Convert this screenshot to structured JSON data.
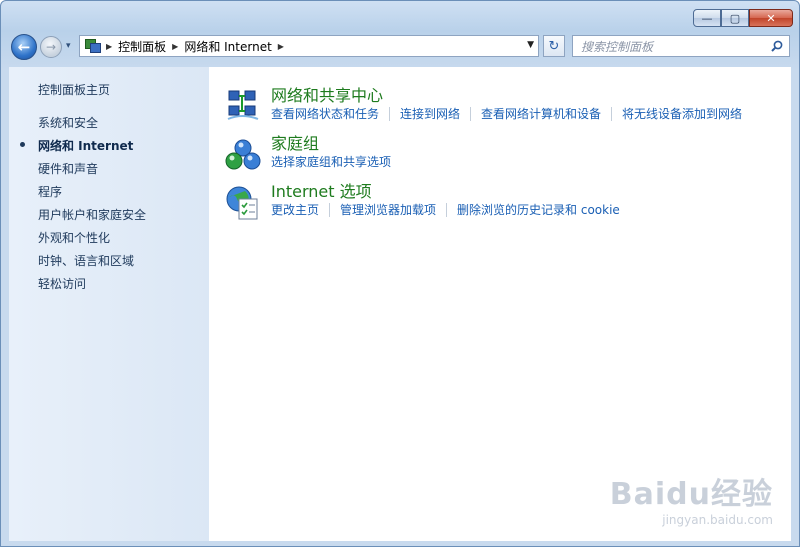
{
  "window": {
    "minimize_glyph": "—",
    "maximize_glyph": "▢",
    "close_glyph": "✕"
  },
  "navigation": {
    "back_glyph": "←",
    "forward_glyph": "→",
    "history_glyph": "▾",
    "breadcrumbs": [
      "控制面板",
      "网络和 Internet"
    ],
    "crumb_separator": "▶",
    "dropdown_glyph": "▼",
    "refresh_glyph": "↻"
  },
  "search": {
    "placeholder": "搜索控制面板"
  },
  "sidebar": {
    "home": "控制面板主页",
    "items": [
      "系统和安全",
      "网络和 Internet",
      "硬件和声音",
      "程序",
      "用户帐户和家庭安全",
      "外观和个性化",
      "时钟、语言和区域",
      "轻松访问"
    ],
    "current_item": "网络和 Internet"
  },
  "categories": [
    {
      "title": "网络和共享中心",
      "icon": "network-center-icon",
      "links": [
        "查看网络状态和任务",
        "连接到网络",
        "查看网络计算机和设备",
        "将无线设备添加到网络"
      ]
    },
    {
      "title": "家庭组",
      "icon": "homegroup-icon",
      "links": [
        "选择家庭组和共享选项"
      ]
    },
    {
      "title": "Internet 选项",
      "icon": "internet-options-icon",
      "links": [
        "更改主页",
        "管理浏览器加载项",
        "删除浏览的历史记录和 cookie"
      ]
    }
  ],
  "watermark": {
    "logo": "Baidu经验",
    "url": "jingyan.baidu.com"
  },
  "colors": {
    "frame": "#b9d1ea",
    "sidebar": "#dbe7f5",
    "category_title": "#1e7b1e",
    "link": "#1a5fb4"
  }
}
